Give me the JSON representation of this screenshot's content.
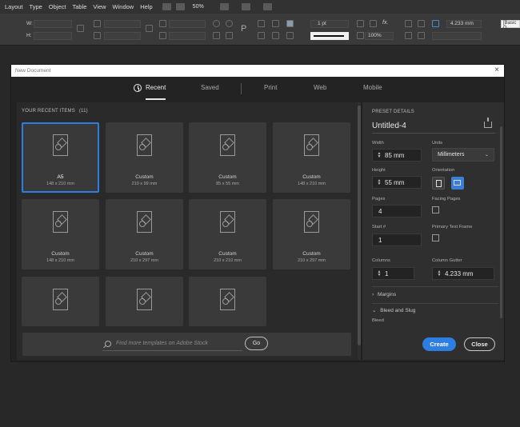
{
  "menubar": {
    "items": [
      "Layout",
      "Type",
      "Object",
      "Table",
      "View",
      "Window",
      "Help"
    ],
    "zoom": "50%"
  },
  "toolbar": {
    "w_label": "W:",
    "h_label": "H:",
    "stroke_weight": "1 pt",
    "scale": "100%",
    "gutter_value": "4.233 mm",
    "style_label": "[Basic G"
  },
  "dialog": {
    "title": "New Document",
    "tabs": [
      "Recent",
      "Saved",
      "Print",
      "Web",
      "Mobile"
    ],
    "active_tab": "Recent"
  },
  "recent": {
    "title": "YOUR RECENT ITEMS",
    "count": "(11)",
    "items": [
      {
        "name": "A5",
        "size": "148 x 210 mm"
      },
      {
        "name": "Custom",
        "size": "210 x 99 mm"
      },
      {
        "name": "Custom",
        "size": "85 x 55 mm"
      },
      {
        "name": "Custom",
        "size": "148 x 210 mm"
      },
      {
        "name": "Custom",
        "size": "148 x 210 mm"
      },
      {
        "name": "Custom",
        "size": "210 x 297 mm"
      },
      {
        "name": "Custom",
        "size": "210 x 210 mm"
      },
      {
        "name": "Custom",
        "size": "210 x 297 mm"
      },
      {
        "name": "",
        "size": ""
      },
      {
        "name": "",
        "size": ""
      },
      {
        "name": "",
        "size": ""
      }
    ]
  },
  "search": {
    "placeholder": "Find more templates on Adobe Stock",
    "go_label": "Go"
  },
  "preset": {
    "header": "PRESET DETAILS",
    "name": "Untitled-4",
    "width_label": "Width",
    "width_value": "85 mm",
    "units_label": "Units",
    "units_value": "Millimeters",
    "height_label": "Height",
    "height_value": "55 mm",
    "orientation_label": "Orientation",
    "pages_label": "Pages",
    "pages_value": "4",
    "facing_pages_label": "Facing Pages",
    "start_label": "Start #",
    "start_value": "1",
    "primary_text_frame_label": "Primary Text Frame",
    "columns_label": "Columns",
    "columns_value": "1",
    "column_gutter_label": "Column Gutter",
    "column_gutter_value": "4.233 mm",
    "margins_label": "Margins",
    "bleed_slug_label": "Bleed and Slug",
    "bleed_label": "Bleed"
  },
  "buttons": {
    "create": "Create",
    "close": "Close"
  },
  "colors": {
    "accent": "#2d7ee0",
    "dialog_bg": "#232323"
  }
}
